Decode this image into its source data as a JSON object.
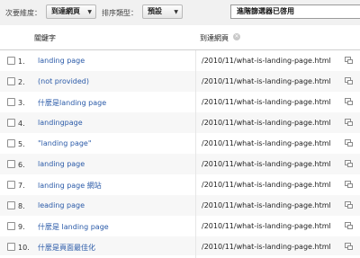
{
  "toolbar": {
    "secondary_dimension_label": "次要維度：",
    "secondary_dimension_value": "到達網頁",
    "sort_type_label": "排序類型：",
    "sort_type_value": "預設",
    "advanced_filter_status": "進階篩選器已啓用"
  },
  "table": {
    "columns": [
      "關鍵字",
      "到達網頁"
    ],
    "rows": [
      {
        "index": "1.",
        "keyword": "landing page",
        "landing_page": "/2010/11/what-is-landing-page.html"
      },
      {
        "index": "2.",
        "keyword": "(not provided)",
        "landing_page": "/2010/11/what-is-landing-page.html"
      },
      {
        "index": "3.",
        "keyword": "什麼是landing page",
        "landing_page": "/2010/11/what-is-landing-page.html"
      },
      {
        "index": "4.",
        "keyword": "landingpage",
        "landing_page": "/2010/11/what-is-landing-page.html"
      },
      {
        "index": "5.",
        "keyword": "\"landing page\"",
        "landing_page": "/2010/11/what-is-landing-page.html"
      },
      {
        "index": "6.",
        "keyword": "landing page",
        "landing_page": "/2010/11/what-is-landing-page.html"
      },
      {
        "index": "7.",
        "keyword": "landing page 網站",
        "landing_page": "/2010/11/what-is-landing-page.html"
      },
      {
        "index": "8.",
        "keyword": "leading page",
        "landing_page": "/2010/11/what-is-landing-page.html"
      },
      {
        "index": "9.",
        "keyword": "什麼是 landing page",
        "landing_page": "/2010/11/what-is-landing-page.html"
      },
      {
        "index": "10.",
        "keyword": "什麼是頁面最佳化",
        "landing_page": "/2010/11/what-is-landing-page.html"
      }
    ]
  },
  "icons": {
    "dropdown": "caret-down-icon",
    "remove_dimension": "close-circle-icon",
    "open_page": "external-link-icon"
  },
  "colors": {
    "keyword_link": "#2a5aa8",
    "toolbar_bg": "#f1f1f1",
    "alt_row_bg": "#f7f7f7"
  }
}
